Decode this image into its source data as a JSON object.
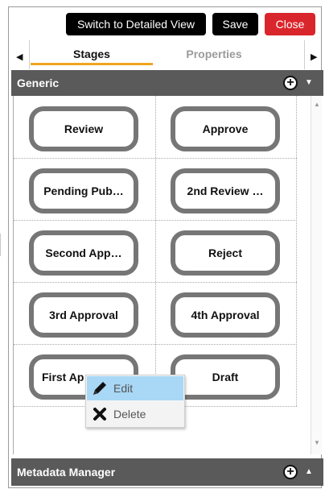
{
  "toolbar": {
    "detailed_view_label": "Switch to Detailed View",
    "save_label": "Save",
    "close_label": "Close",
    "close_color": "#d9262c"
  },
  "tabs": {
    "stages_label": "Stages",
    "properties_label": "Properties",
    "active": "Stages",
    "accent_color": "#f0a51e",
    "prev_icon": "caret-left-icon",
    "next_icon": "caret-right-icon"
  },
  "sections": {
    "generic": {
      "title": "Generic",
      "expanded": true,
      "add_icon": "plus-circle-icon",
      "toggle_icon": "caret-down-icon"
    },
    "metadata": {
      "title": "Metadata Manager",
      "expanded": false,
      "add_icon": "plus-circle-icon",
      "toggle_icon": "caret-up-icon"
    }
  },
  "stages": [
    {
      "label": "Review"
    },
    {
      "label": "Approve"
    },
    {
      "label": "Pending Pub…"
    },
    {
      "label": "2nd Review …"
    },
    {
      "label": "Second App…"
    },
    {
      "label": "Reject"
    },
    {
      "label": "3rd Approval"
    },
    {
      "label": "4th Approval"
    },
    {
      "label": "First Ap"
    },
    {
      "label": "Draft"
    }
  ],
  "context_menu": {
    "edit_label": "Edit",
    "edit_icon": "pencil-icon",
    "delete_label": "Delete",
    "delete_icon": "x-icon",
    "highlight_color": "#a8d8f6"
  }
}
